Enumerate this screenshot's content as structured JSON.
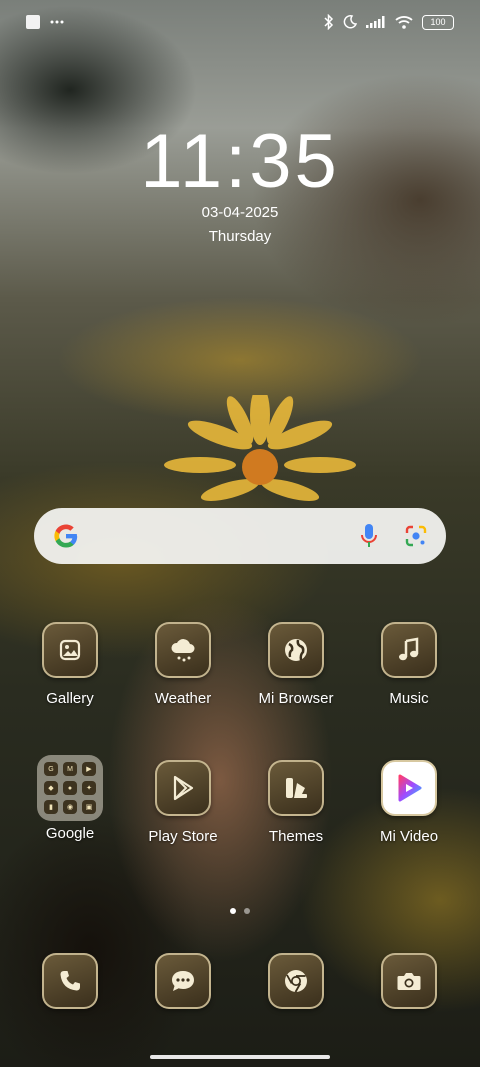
{
  "status_bar": {
    "battery": "100",
    "icons": [
      "notification-square-icon",
      "more-dots-icon",
      "bluetooth-icon",
      "moon-icon",
      "signal-icon",
      "wifi-icon",
      "battery-icon"
    ]
  },
  "clock": {
    "time": "11:35",
    "date": "03-04-2025",
    "weekday": "Thursday"
  },
  "search": {
    "icons": [
      "google-g-icon",
      "microphone-icon",
      "lens-icon"
    ]
  },
  "apps_row1": [
    {
      "label": "Gallery",
      "icon": "gallery-icon"
    },
    {
      "label": "Weather",
      "icon": "weather-icon"
    },
    {
      "label": "Mi Browser",
      "icon": "globe-icon"
    },
    {
      "label": "Music",
      "icon": "music-note-icon"
    }
  ],
  "apps_row2": [
    {
      "label": "Google",
      "icon": "folder-icon"
    },
    {
      "label": "Play Store",
      "icon": "play-store-icon"
    },
    {
      "label": "Themes",
      "icon": "themes-icon"
    },
    {
      "label": "Mi Video",
      "icon": "mi-video-icon"
    }
  ],
  "dock": [
    {
      "icon": "phone-icon"
    },
    {
      "icon": "messages-icon"
    },
    {
      "icon": "chrome-icon"
    },
    {
      "icon": "camera-icon"
    }
  ],
  "page_indicator": {
    "count": 2,
    "active": 1
  },
  "colors": {
    "icon_tint": "#f4ecd4",
    "icon_bg": "#4a3c22",
    "google_blue": "#4285F4",
    "google_red": "#EA4335",
    "google_yellow": "#FBBC05",
    "google_green": "#34A853"
  }
}
